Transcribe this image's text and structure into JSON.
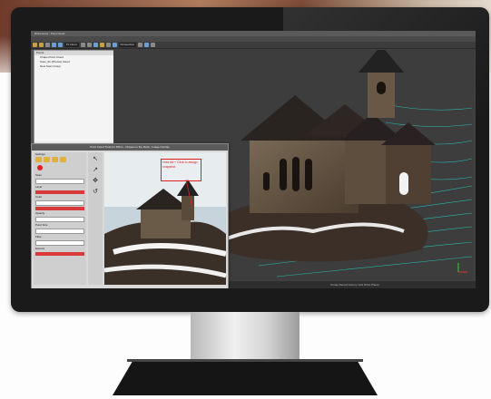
{
  "app": {
    "title": "Rhinoceros - Point Cloud",
    "menu": [
      "File",
      "Edit",
      "View",
      "Curve",
      "Surface",
      "Solid",
      "Mesh",
      "Dimension",
      "Transform",
      "Tools",
      "Analyze",
      "Render",
      "Panels",
      "Help"
    ],
    "toolbar_field": "Pt Cloud",
    "toolbar_field2": "Perspective"
  },
  "tree": {
    "header": "Points",
    "items": [
      "Chapel Point Cloud",
      "Scan_01 (Photos) Cloud",
      "New Scan Group"
    ]
  },
  "dialog": {
    "title": "Point Cloud Tools for Rhino - Chapel on the Rock - Image Overlay",
    "left_header": "Settings",
    "sections": [
      "Scan",
      "Layer",
      "Color",
      "Opacity",
      "Point Size",
      "Filter",
      "Extents"
    ],
    "annotation": "Hold Alt + Click to assign snapshot"
  },
  "status": {
    "left": "Ready",
    "right": "Osnap  Record History  Grid  Ortho  Planar"
  },
  "colors": {
    "viewport_bg": "#3d3d3d",
    "grid_line": "#2ab7b0",
    "annotation": "#e02020",
    "bezel": "#1a1a1a"
  }
}
